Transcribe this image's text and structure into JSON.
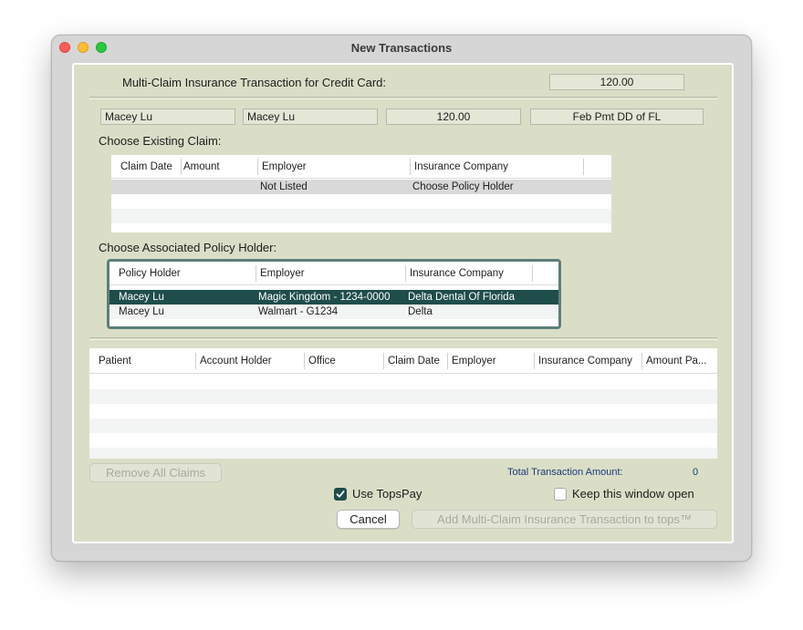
{
  "window": {
    "title": "New Transactions"
  },
  "header": {
    "label": "Multi-Claim Insurance Transaction for Credit Card:",
    "amount": "120.00"
  },
  "summary": {
    "patient": "Macey Lu",
    "account_holder": "Macey Lu",
    "amount": "120.00",
    "description": "Feb Pmt DD of FL"
  },
  "claims": {
    "label": "Choose Existing Claim:",
    "columns": [
      "Claim Date",
      "Amount",
      "Employer",
      "Insurance Company"
    ],
    "rows": [
      {
        "claim_date": "",
        "amount": "",
        "employer": "Not Listed",
        "insurance_company": "Choose Policy Holder"
      }
    ]
  },
  "policy_holders": {
    "label": "Choose Associated Policy Holder:",
    "columns": [
      "Policy Holder",
      "Employer",
      "Insurance Company"
    ],
    "rows": [
      {
        "policy_holder": "Macey Lu",
        "employer": "Magic Kingdom - 1234-0000",
        "insurance_company": "Delta Dental Of Florida",
        "selected": true
      },
      {
        "policy_holder": "Macey Lu",
        "employer": "Walmart - G1234",
        "insurance_company": "Delta",
        "selected": false
      }
    ]
  },
  "transactions": {
    "columns": [
      "Patient",
      "Account Holder",
      "Office",
      "Claim Date",
      "Employer",
      "Insurance Company",
      "Amount Pa..."
    ]
  },
  "footer": {
    "remove_all": "Remove All Claims",
    "total_label": "Total Transaction Amount:",
    "total_value": "0",
    "use_topspay": "Use TopsPay",
    "use_topspay_checked": true,
    "keep_open": "Keep this window open",
    "keep_open_checked": false,
    "cancel": "Cancel",
    "add": "Add Multi-Claim Insurance Transaction to tops™"
  },
  "colors": {
    "panel": "#dadec7",
    "selection": "#1f4d4b",
    "total_text": "#1c3b7a"
  }
}
